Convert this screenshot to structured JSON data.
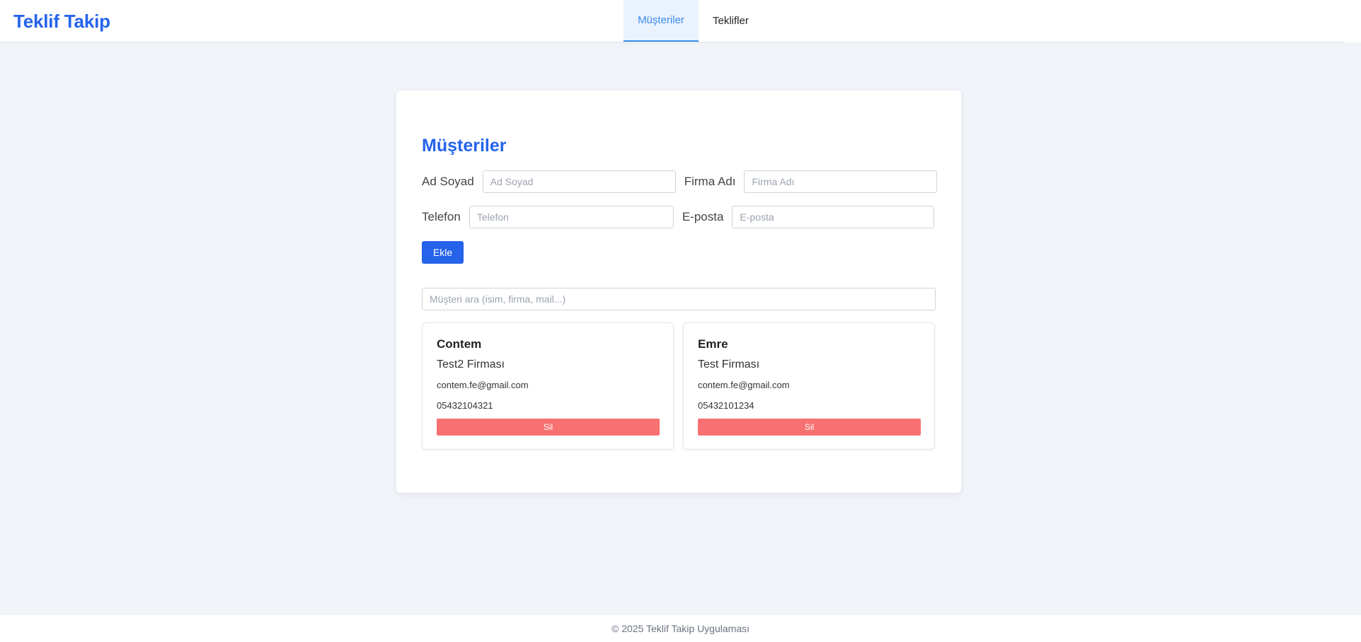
{
  "header": {
    "brand": "Teklif Takip",
    "tabs": [
      {
        "label": "Müşteriler",
        "active": true
      },
      {
        "label": "Teklifler",
        "active": false
      }
    ]
  },
  "main": {
    "title": "Müşteriler",
    "form": {
      "name_label": "Ad Soyad",
      "name_placeholder": "Ad Soyad",
      "company_label": "Firma Adı",
      "company_placeholder": "Firma Adı",
      "phone_label": "Telefon",
      "phone_placeholder": "Telefon",
      "email_label": "E-posta",
      "email_placeholder": "E-posta",
      "add_label": "Ekle"
    },
    "search_placeholder": "Müşteri ara (isim, firma, mail...)",
    "customers": [
      {
        "name": "Contem",
        "company": "Test2 Firması",
        "email": "contem.fe@gmail.com",
        "phone": "05432104321",
        "delete_label": "Sil"
      },
      {
        "name": "Emre",
        "company": "Test Firması",
        "email": "contem.fe@gmail.com",
        "phone": "05432101234",
        "delete_label": "Sil"
      }
    ]
  },
  "footer": {
    "text": "© 2025 Teklif Takip Uygulaması"
  },
  "colors": {
    "accent": "#2563eb",
    "tab_active": "#3b8ced",
    "danger": "#f87171",
    "background": "#f0f4f8"
  }
}
